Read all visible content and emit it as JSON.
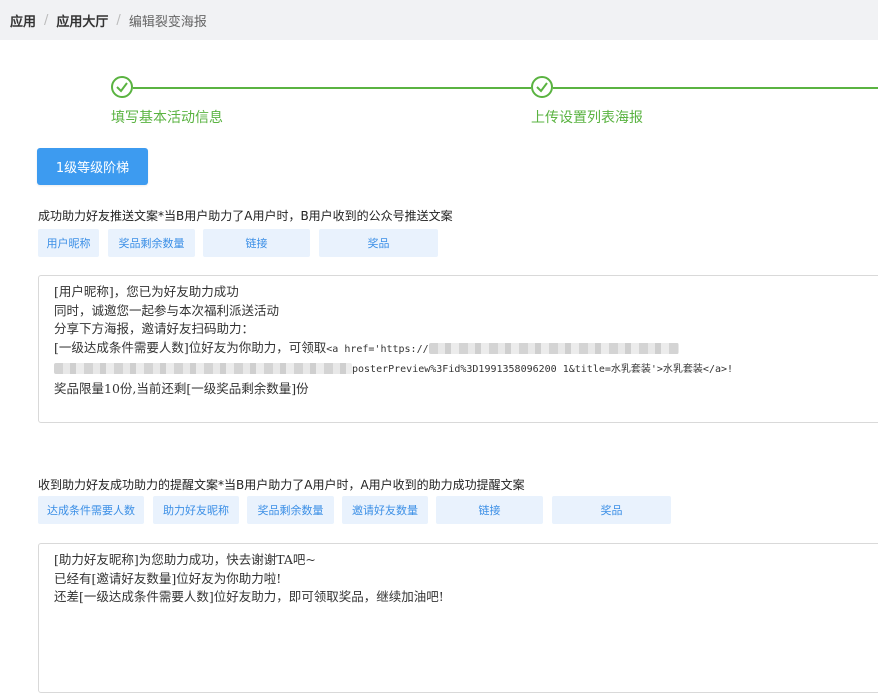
{
  "breadcrumb": {
    "items": [
      "应用",
      "应用大厅",
      "编辑裂变海报"
    ],
    "separator": "/"
  },
  "steps": [
    {
      "label": "填写基本活动信息",
      "done": true
    },
    {
      "label": "上传设置列表海报",
      "done": true
    }
  ],
  "level_button": {
    "label": "1级等级阶梯"
  },
  "section1": {
    "title": "成功助力好友推送文案*当B用户助力了A用户时，B用户收到的公众号推送文案",
    "tags": [
      "用户昵称",
      "奖品剩余数量",
      "链接",
      "奖品"
    ],
    "lines": [
      "[用户昵称]，您已为好友助力成功",
      "同时，诚邀您一起参与本次福利派送活动",
      "分享下方海报，邀请好友扫码助力：",
      "[一级达成条件需要人数]位好友为你助力，可领取",
      "<a href='https://",
      "posterPreview%3Fid%3D1991358096200 1&title=水乳套装'>水乳套装</a>!",
      "奖品限量10份,当前还剩[一级奖品剩余数量]份"
    ]
  },
  "section2": {
    "title": "收到助力好友成功助力的提醒文案*当B用户助力了A用户时，A用户收到的助力成功提醒文案",
    "tags": [
      "达成条件需要人数",
      "助力好友昵称",
      "奖品剩余数量",
      "邀请好友数量",
      "链接",
      "奖品"
    ],
    "lines": [
      "[助力好友昵称]为您助力成功，快去谢谢TA吧~",
      "已经有[邀请好友数量]位好友为你助力啦!",
      "还差[一级达成条件需要人数]位好友助力，即可领取奖品，继续加油吧!"
    ]
  },
  "colors": {
    "accent": "#3d9bf0",
    "success": "#5ab341",
    "tag_bg": "#e9f2fd",
    "tag_text": "#3b8fe6"
  }
}
